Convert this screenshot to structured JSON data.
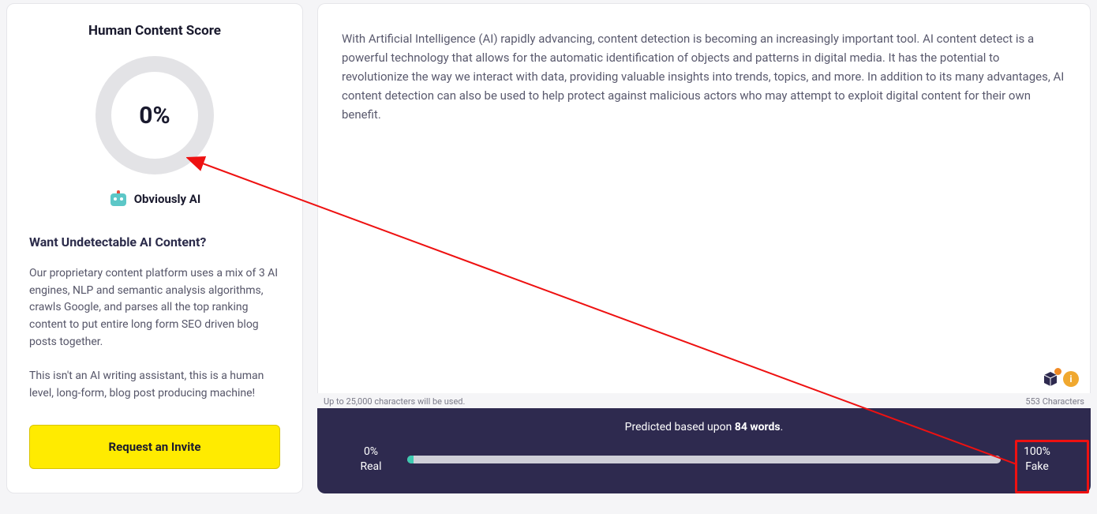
{
  "score": {
    "title": "Human Content Score",
    "percent": "0%",
    "label": "Obviously AI"
  },
  "und": {
    "heading": "Want Undetectable AI Content?",
    "p1": "Our proprietary content platform uses a mix of 3 AI engines, NLP and semantic analysis algorithms, crawls Google, and parses all the top ranking content to put entire long form SEO driven blog posts together.",
    "p2": "This isn't an AI writing assistant, this is a human level, long-form, blog post producing machine!",
    "cta": "Request an Invite"
  },
  "editor": {
    "text": "With Artificial Intelligence (AI) rapidly advancing, content detection is becoming an increasingly important tool. AI content detect is a powerful technology that allows for the automatic identification of objects and patterns in digital media. It has the potential to revolutionize the way we interact with data, providing valuable insights into trends, topics, and more. In addition to its many advantages, AI content detection can also be used to help protect against malicious actors who may attempt to exploit digital content for their own benefit."
  },
  "meta": {
    "limit": "Up to 25,000 characters will be used.",
    "count": "553 Characters"
  },
  "pred": {
    "prefix": "Predicted based upon ",
    "bold": "84 words",
    "suffix": ".",
    "left_pct": "0%",
    "left_lbl": "Real",
    "right_pct": "100%",
    "right_lbl": "Fake"
  },
  "info_glyph": "i"
}
